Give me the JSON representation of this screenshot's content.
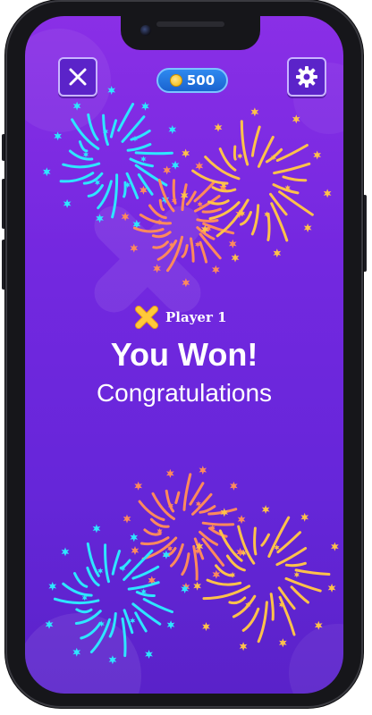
{
  "header": {
    "close_icon": "close-x-icon",
    "settings_icon": "gear-icon",
    "coins": "500",
    "coin_icon": "coin-icon"
  },
  "result": {
    "player_icon": "x-mark-icon",
    "player": "Player 1",
    "title": "You Won!",
    "subtitle": "Congratulations"
  },
  "colors": {
    "background_top": "#8a2fe6",
    "background_bottom": "#5a22c9",
    "firework_cyan": "#2ee6ff",
    "firework_orange": "#ff8a5c",
    "firework_yellow": "#ffc24a",
    "x_mark": "#ffc93a"
  }
}
